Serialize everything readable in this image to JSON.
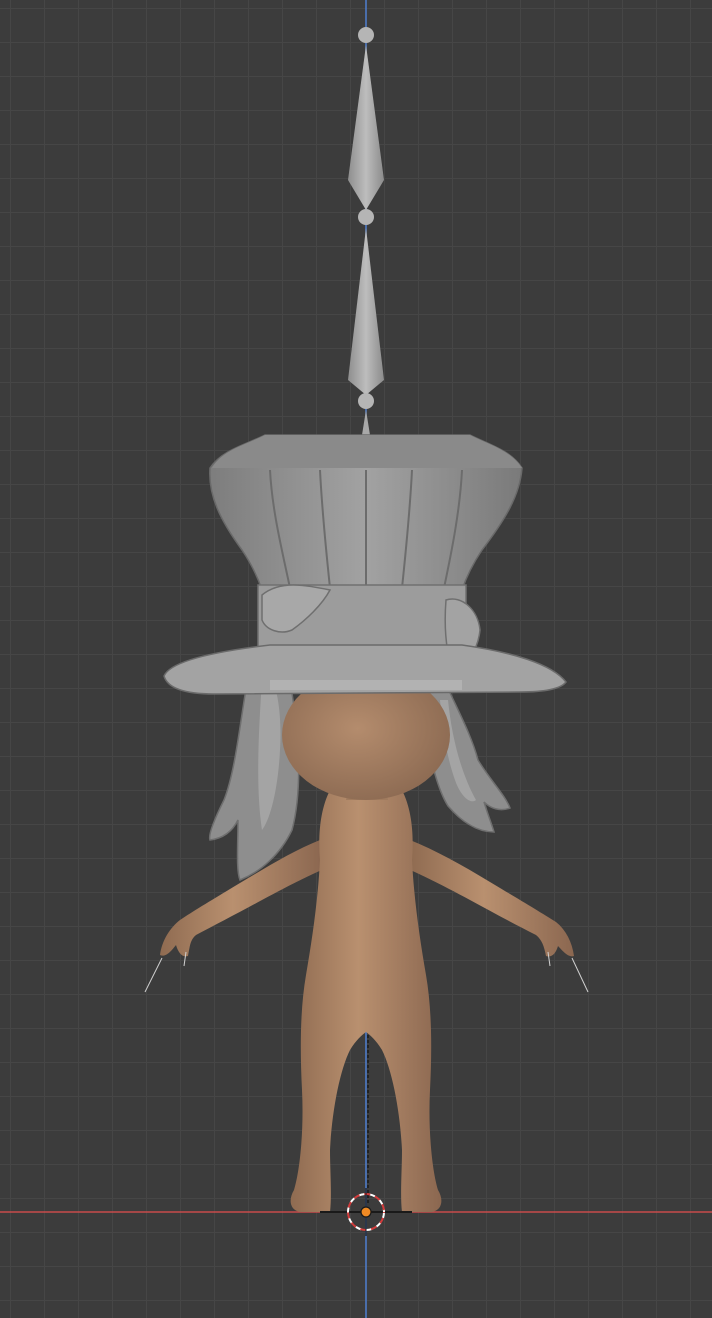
{
  "viewport": {
    "mode": "3d-viewport",
    "view": "front-orthographic",
    "grid": true
  },
  "axes": {
    "x_axis_color": "#c84b4b",
    "z_axis_color": "#4f7fd0"
  },
  "scene": {
    "objects": [
      "armature-bones",
      "top-hat",
      "hair",
      "body"
    ],
    "cursor": "3d-cursor",
    "origin_color": "#f08a24"
  },
  "colors": {
    "background": "#3c3c3c",
    "mesh_gray": "#9a9a9a",
    "skin": "#b08566"
  }
}
